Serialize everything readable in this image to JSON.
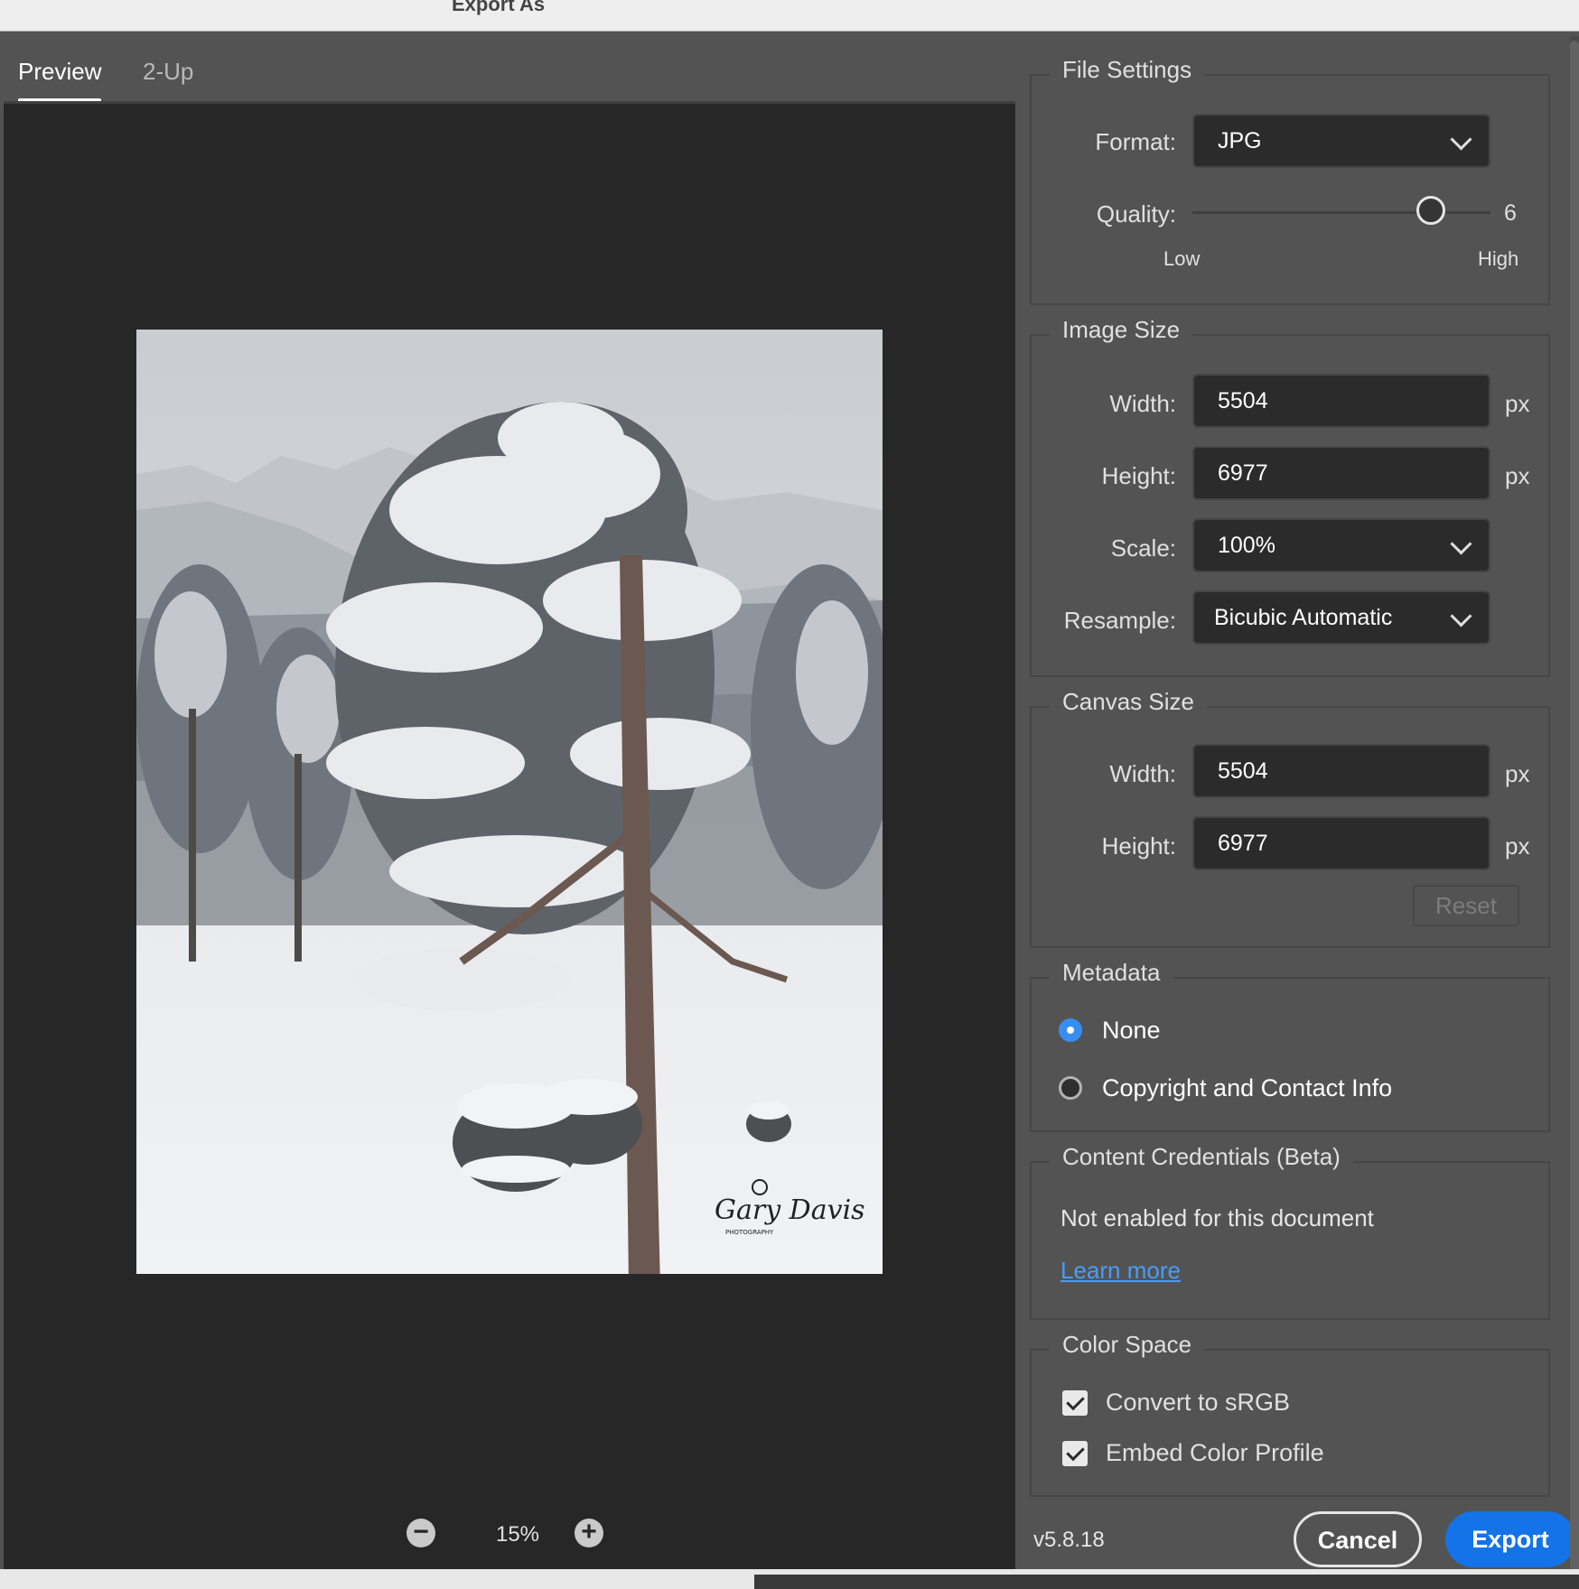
{
  "window": {
    "title": "Export As"
  },
  "tabs": [
    {
      "label": "Preview",
      "active": true
    },
    {
      "label": "2-Up",
      "active": false
    }
  ],
  "preview": {
    "zoom": "15%",
    "watermark_signature": "Gary Davis",
    "watermark_sub": "PHOTOGRAPHY"
  },
  "file_settings": {
    "legend": "File Settings",
    "format_label": "Format:",
    "format_value": "JPG",
    "quality_label": "Quality:",
    "quality_value": "6",
    "quality_fraction": 0.8,
    "quality_low": "Low",
    "quality_high": "High"
  },
  "image_size": {
    "legend": "Image Size",
    "width_label": "Width:",
    "width_value": "5504",
    "height_label": "Height:",
    "height_value": "6977",
    "unit": "px",
    "scale_label": "Scale:",
    "scale_value": "100%",
    "resample_label": "Resample:",
    "resample_value": "Bicubic Automatic"
  },
  "canvas_size": {
    "legend": "Canvas Size",
    "width_label": "Width:",
    "width_value": "5504",
    "height_label": "Height:",
    "height_value": "6977",
    "unit": "px",
    "reset_label": "Reset"
  },
  "metadata": {
    "legend": "Metadata",
    "options": [
      {
        "label": "None",
        "selected": true
      },
      {
        "label": "Copyright and Contact Info",
        "selected": false
      }
    ]
  },
  "content_credentials": {
    "legend": "Content Credentials (Beta)",
    "status": "Not enabled for this document",
    "link": "Learn more"
  },
  "color_space": {
    "legend": "Color Space",
    "convert_label": "Convert to sRGB",
    "convert_checked": true,
    "embed_label": "Embed Color Profile",
    "embed_checked": true
  },
  "footer": {
    "version": "v5.8.18",
    "cancel_label": "Cancel",
    "export_label": "Export"
  },
  "colors": {
    "accent": "#1473e6",
    "radio_selected": "#378ef0",
    "link": "#4b9cf5",
    "panel_bg": "#535353",
    "preview_bg": "#272727"
  },
  "icons": {
    "zoom_out": "minus-circle-icon",
    "zoom_in": "plus-circle-icon",
    "dropdown": "chevron-down-icon"
  }
}
